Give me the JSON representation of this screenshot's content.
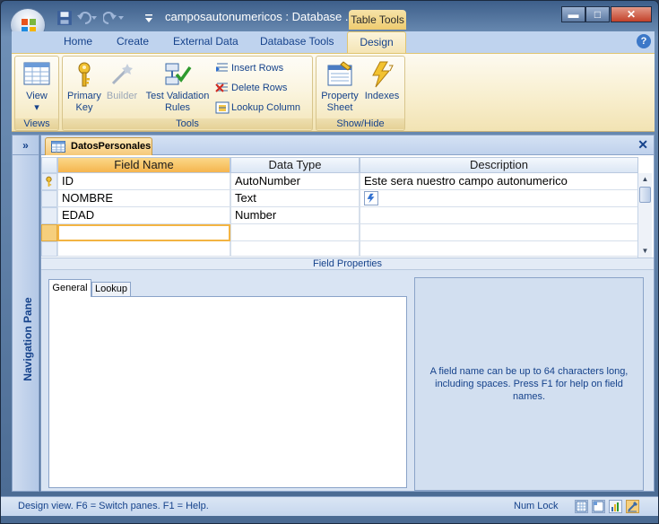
{
  "titlebar": {
    "title": "camposautonumericos : Database ...",
    "context_tab": "Table Tools",
    "minimize": "▬",
    "maximize": "□",
    "close": "✕"
  },
  "ribbon": {
    "tabs": [
      "Home",
      "Create",
      "External Data",
      "Database Tools",
      "Design"
    ],
    "help": "?",
    "groups": {
      "views": {
        "label": "Views",
        "view": "View"
      },
      "tools": {
        "label": "Tools",
        "primary_key": "Primary Key",
        "builder": "Builder",
        "test_validation": "Test Validation Rules",
        "insert_rows": "Insert Rows",
        "delete_rows": "Delete Rows",
        "lookup_column": "Lookup Column"
      },
      "showhide": {
        "label": "Show/Hide",
        "property_sheet": "Property Sheet",
        "indexes": "Indexes"
      }
    }
  },
  "nav": {
    "expand": "»",
    "label": "Navigation Pane"
  },
  "document": {
    "tab": "DatosPersonales",
    "close": "✕",
    "columns": [
      "Field Name",
      "Data Type",
      "Description"
    ],
    "rows": [
      {
        "field": "ID",
        "type": "AutoNumber",
        "desc": "Este sera nuestro campo autonumerico"
      },
      {
        "field": "NOMBRE",
        "type": "Text",
        "desc": ""
      },
      {
        "field": "EDAD",
        "type": "Number",
        "desc": ""
      }
    ],
    "field_properties": "Field Properties",
    "prop_tabs": [
      "General",
      "Lookup"
    ],
    "help_text": "A field name can be up to 64 characters long, including spaces.  Press F1 for help on field names."
  },
  "statusbar": {
    "text": "Design view.  F6 = Switch panes.  F1 = Help.",
    "numlock": "Num Lock"
  }
}
